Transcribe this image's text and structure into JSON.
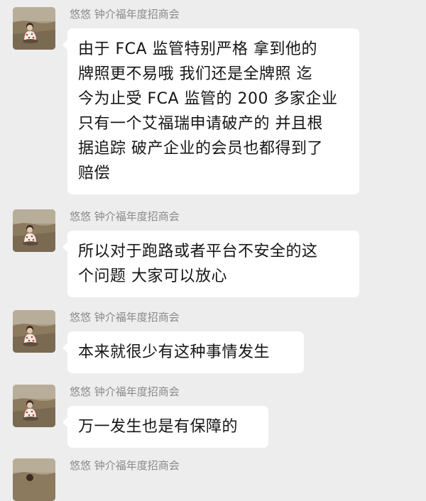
{
  "messages": [
    {
      "sender": "悠悠  钟介福年度招商会",
      "avatar_icon": "avatar-child-in-field",
      "text": "由于 FCA 监管特别严格  拿到他的\n牌照更不易哦 我们还是全牌照   迄\n今为止受 FCA 监管的 200 多家企业\n只有一个艾福瑞申请破产的 并且根\n据追踪 破产企业的会员也都得到了\n赔偿"
    },
    {
      "sender": "悠悠  钟介福年度招商会",
      "avatar_icon": "avatar-child-in-field",
      "text": "所以对于跑路或者平台不安全的这\n个问题 大家可以放心"
    },
    {
      "sender": "悠悠  钟介福年度招商会",
      "avatar_icon": "avatar-child-in-field",
      "text": "本来就很少有这种事情发生"
    },
    {
      "sender": "悠悠  钟介福年度招商会",
      "avatar_icon": "avatar-child-in-field",
      "text": "万一发生也是有保障的"
    },
    {
      "sender": "悠悠  钟介福年度招商会",
      "avatar_icon": "avatar-child-in-field",
      "text": ""
    }
  ],
  "colors": {
    "background": "#ededed",
    "bubble": "#ffffff",
    "sender_text": "#8a8a8a",
    "message_text": "#161616"
  }
}
